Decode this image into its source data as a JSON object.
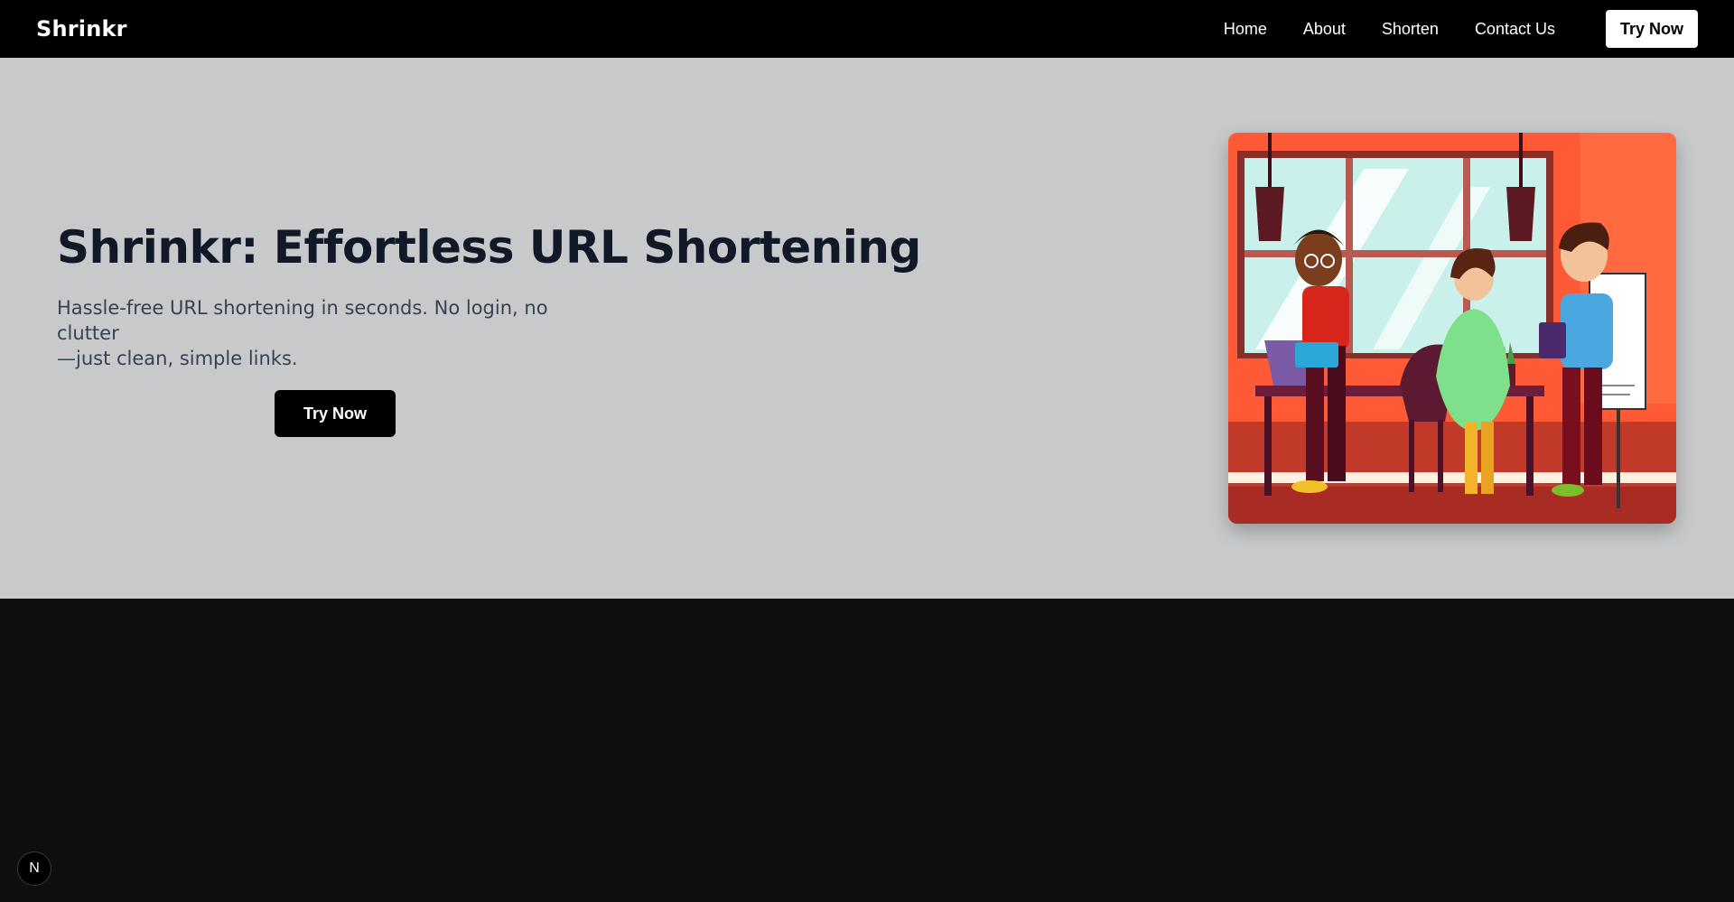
{
  "header": {
    "brand": "Shrinkr",
    "nav": [
      "Home",
      "About",
      "Shorten",
      "Contact Us"
    ],
    "cta_label": "Try Now"
  },
  "hero": {
    "title": "Shrinkr: Effortless URL Shortening",
    "subtitle_line1": "Hassle-free URL shortening in seconds. No login, no clutter",
    "subtitle_line2": "—just clean, simple links.",
    "cta_label": "Try Now",
    "illustration_icon": "team-office-illustration"
  },
  "footer_badge": {
    "glyph": "N",
    "icon": "nextjs-badge-icon"
  },
  "colors": {
    "navbar_bg": "#000000",
    "hero_bg": "#c8c9cb",
    "page_dark_bg": "#0e0e0e",
    "title_color": "#111827",
    "cta_bg": "#000000",
    "nav_cta_bg": "#ffffff",
    "illustration_accent": "#ff5a36"
  }
}
